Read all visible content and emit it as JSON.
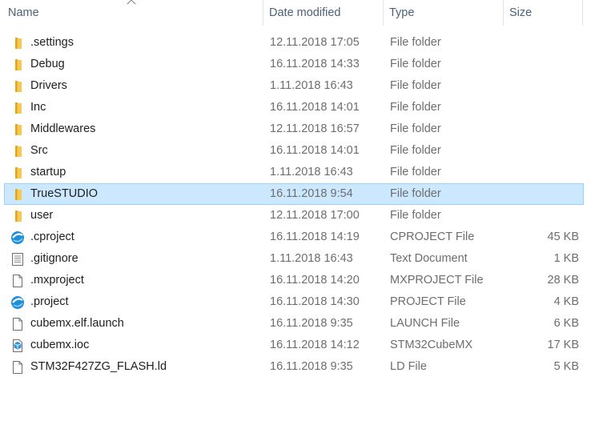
{
  "columns": {
    "name": "Name",
    "date": "Date modified",
    "type": "Type",
    "size": "Size"
  },
  "sort": {
    "column": "name",
    "direction": "ascending",
    "icon": "chevron-up-icon"
  },
  "colors": {
    "folder": "#f8c94f",
    "folder_dark": "#e5a91c",
    "selection_bg": "#cce8ff",
    "selection_border": "#99d1ff",
    "eclipse_blue": "#1f8fd8"
  },
  "files": [
    {
      "name": ".settings",
      "date": "12.11.2018 17:05",
      "type": "File folder",
      "size": "",
      "icon": "folder-icon"
    },
    {
      "name": "Debug",
      "date": "16.11.2018 14:33",
      "type": "File folder",
      "size": "",
      "icon": "folder-icon"
    },
    {
      "name": "Drivers",
      "date": "1.11.2018 16:43",
      "type": "File folder",
      "size": "",
      "icon": "folder-icon"
    },
    {
      "name": "Inc",
      "date": "16.11.2018 14:01",
      "type": "File folder",
      "size": "",
      "icon": "folder-icon"
    },
    {
      "name": "Middlewares",
      "date": "12.11.2018 16:57",
      "type": "File folder",
      "size": "",
      "icon": "folder-icon"
    },
    {
      "name": "Src",
      "date": "16.11.2018 14:01",
      "type": "File folder",
      "size": "",
      "icon": "folder-icon"
    },
    {
      "name": "startup",
      "date": "1.11.2018 16:43",
      "type": "File folder",
      "size": "",
      "icon": "folder-icon"
    },
    {
      "name": "TrueSTUDIO",
      "date": "16.11.2018 9:54",
      "type": "File folder",
      "size": "",
      "icon": "folder-icon",
      "selected": true
    },
    {
      "name": "user",
      "date": "12.11.2018 17:00",
      "type": "File folder",
      "size": "",
      "icon": "folder-icon"
    },
    {
      "name": ".cproject",
      "date": "16.11.2018 14:19",
      "type": "CPROJECT File",
      "size": "45 KB",
      "icon": "eclipse-icon"
    },
    {
      "name": ".gitignore",
      "date": "1.11.2018 16:43",
      "type": "Text Document",
      "size": "1 KB",
      "icon": "text-document-icon"
    },
    {
      "name": ".mxproject",
      "date": "16.11.2018 14:20",
      "type": "MXPROJECT File",
      "size": "28 KB",
      "icon": "blank-file-icon"
    },
    {
      "name": ".project",
      "date": "16.11.2018 14:30",
      "type": "PROJECT File",
      "size": "4 KB",
      "icon": "eclipse-icon"
    },
    {
      "name": "cubemx.elf.launch",
      "date": "16.11.2018 9:35",
      "type": "LAUNCH File",
      "size": "6 KB",
      "icon": "blank-file-icon"
    },
    {
      "name": "cubemx.ioc",
      "date": "16.11.2018 14:12",
      "type": "STM32CubeMX",
      "size": "17 KB",
      "icon": "cube-file-icon"
    },
    {
      "name": "STM32F427ZG_FLASH.ld",
      "date": "16.11.2018 9:35",
      "type": "LD File",
      "size": "5 KB",
      "icon": "blank-file-icon"
    }
  ]
}
